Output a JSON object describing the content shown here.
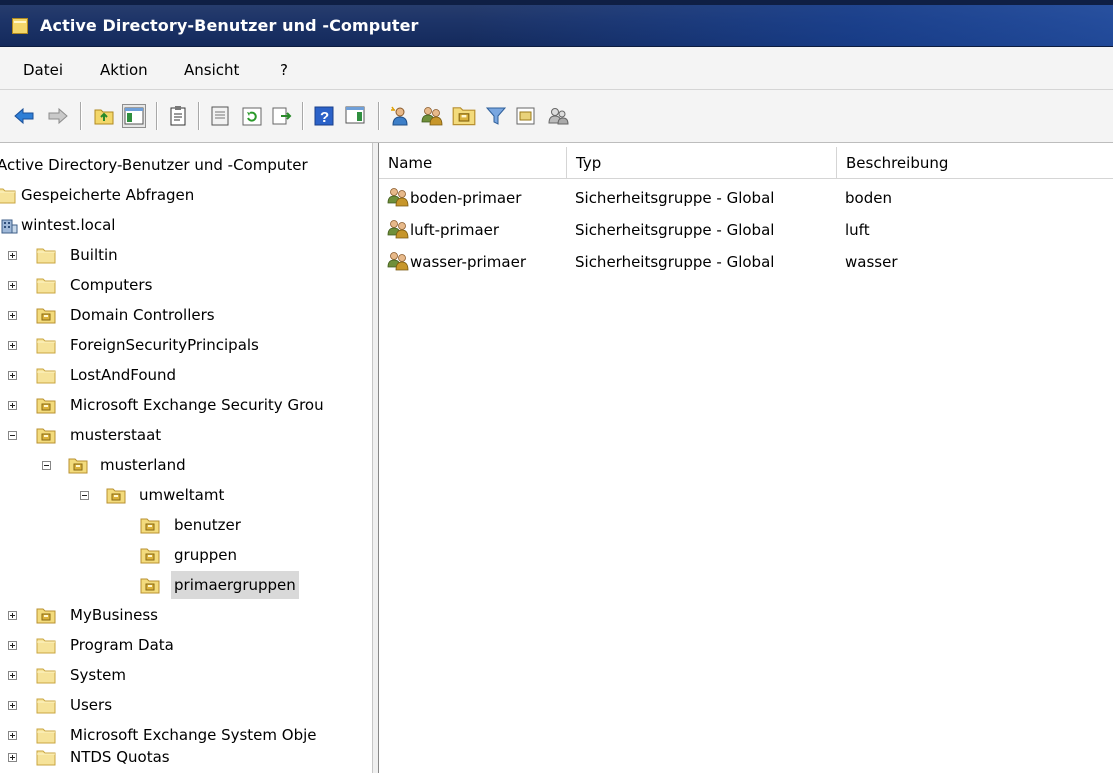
{
  "window": {
    "title": "Active Directory-Benutzer und -Computer"
  },
  "menu": [
    "Datei",
    "Aktion",
    "Ansicht",
    "?"
  ],
  "toolbar": {
    "buttons": [
      "back-icon",
      "forward-icon",
      "up-icon",
      "show-hide-console-tree-icon",
      "export-list-icon",
      "properties-icon",
      "refresh-icon",
      "export-icon",
      "help-icon",
      "show-hide-action-pane-icon",
      "new-user-icon",
      "new-group-icon",
      "new-ou-icon",
      "filter-icon",
      "find-icon",
      "delegate-control-icon"
    ]
  },
  "tree": {
    "root": "Active Directory-Benutzer und -Computer",
    "saved_queries": "Gespeicherte Abfragen",
    "domain": "wintest.local",
    "items": [
      {
        "label": "Builtin"
      },
      {
        "label": "Computers"
      },
      {
        "label": "Domain Controllers"
      },
      {
        "label": "ForeignSecurityPrincipals"
      },
      {
        "label": "LostAndFound"
      },
      {
        "label": "Microsoft Exchange Security Grou"
      },
      {
        "label": "musterstaat"
      },
      {
        "label": "musterland"
      },
      {
        "label": "umweltamt"
      },
      {
        "label": "benutzer"
      },
      {
        "label": "gruppen"
      },
      {
        "label": "primaergruppen"
      },
      {
        "label": "MyBusiness"
      },
      {
        "label": "Program Data"
      },
      {
        "label": "System"
      },
      {
        "label": "Users"
      },
      {
        "label": "Microsoft Exchange System Obje"
      },
      {
        "label": "NTDS Quotas"
      }
    ]
  },
  "list": {
    "columns": [
      "Name",
      "Typ",
      "Beschreibung"
    ],
    "rows": [
      {
        "name": "boden-primaer",
        "type": "Sicherheitsgruppe - Global",
        "description": "boden"
      },
      {
        "name": "luft-primaer",
        "type": "Sicherheitsgruppe - Global",
        "description": "luft"
      },
      {
        "name": "wasser-primaer",
        "type": "Sicherheitsgruppe - Global",
        "description": "wasser"
      }
    ]
  },
  "colors": {
    "title_bar": "#1d3468",
    "selection": "#d9d9d9",
    "folder": "#f6e39a",
    "ou_folder": "#e9c85a"
  }
}
